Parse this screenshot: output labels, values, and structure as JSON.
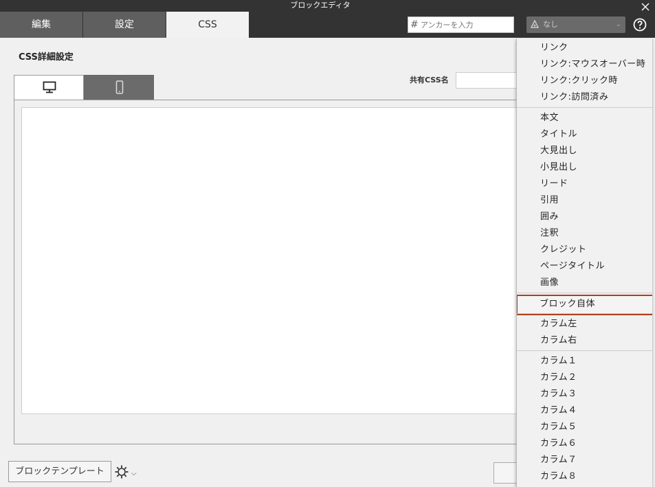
{
  "window": {
    "title": "ブロックエディタ"
  },
  "tabs": [
    {
      "label": "編集"
    },
    {
      "label": "設定"
    },
    {
      "label": "CSS",
      "active": true
    }
  ],
  "anchor": {
    "placeholder": "アンカーを入力"
  },
  "style_select": {
    "value": "なし"
  },
  "main": {
    "section_title": "CSS詳細設定",
    "shared_css_label": "共有CSS名",
    "shared_css_value": ""
  },
  "footer": {
    "template_button": "ブロックテンプレート"
  },
  "dropdown": {
    "groups": [
      [
        "リンク",
        "リンク:マウスオーバー時",
        "リンク:クリック時",
        "リンク:訪問済み"
      ],
      [
        "本文",
        "タイトル",
        "大見出し",
        "小見出し",
        "リード",
        "引用",
        "囲み",
        "注釈",
        "クレジット",
        "ページタイトル",
        "画像"
      ],
      [
        "ブロック自体"
      ],
      [
        "カラム左",
        "カラム右"
      ],
      [
        "カラム１",
        "カラム２",
        "カラム３",
        "カラム４",
        "カラム５",
        "カラム６",
        "カラム７",
        "カラム８"
      ]
    ],
    "selected": "ブロック自体"
  },
  "colors": {
    "topbar": "#333333",
    "selection_border": "#b0401c"
  }
}
